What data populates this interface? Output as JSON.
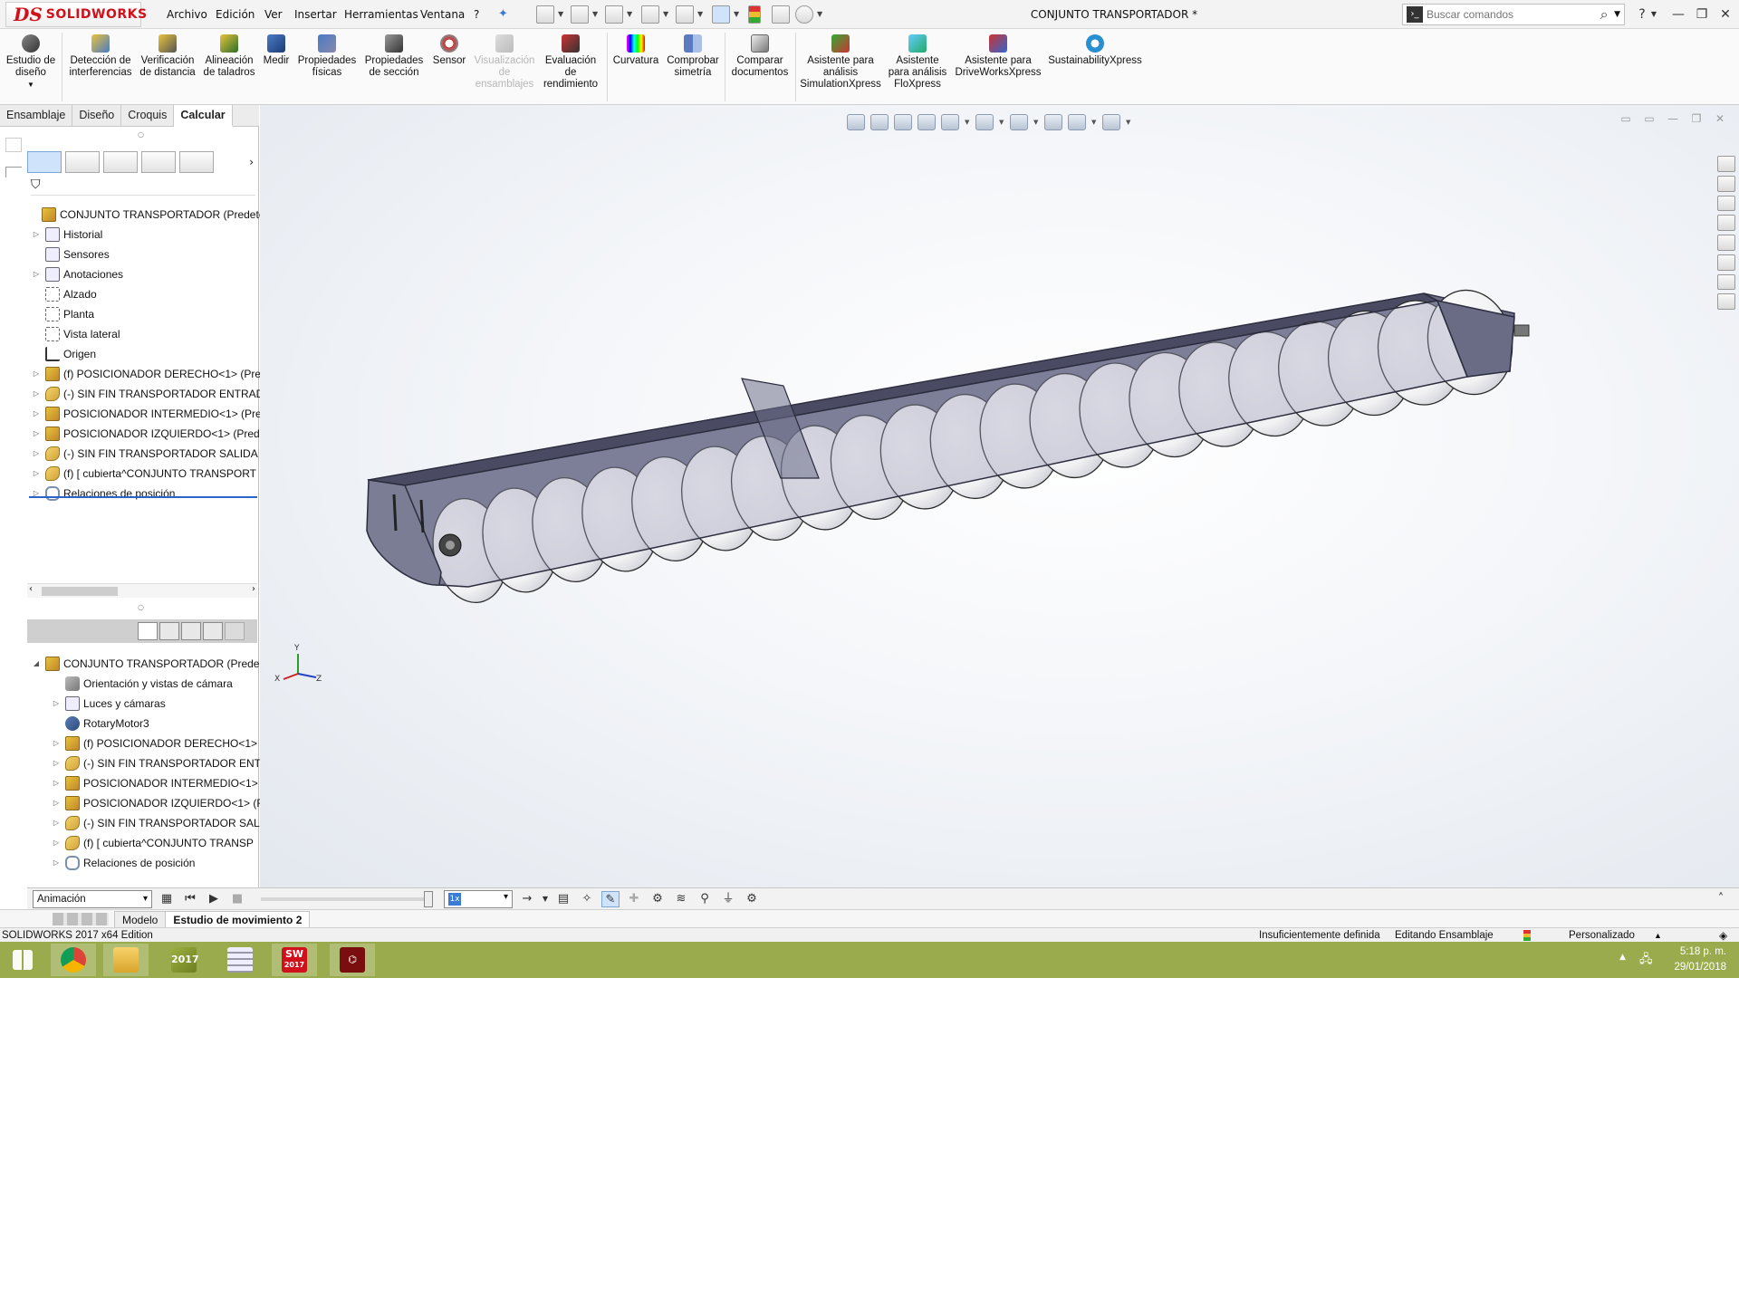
{
  "app": {
    "brand_prefix": "DS",
    "brand": "SOLIDWORKS",
    "document_title": "CONJUNTO TRANSPORTADOR *",
    "menus": [
      "Archivo",
      "Edición",
      "Ver",
      "Insertar",
      "Herramientas",
      "Ventana",
      "?"
    ],
    "search_placeholder": "Buscar comandos",
    "help": "?"
  },
  "ribbon": {
    "design_study": "Estudio de diseño",
    "buttons": [
      {
        "label": "Detección de interferencias",
        "icon": "interference-icon",
        "enabled": true
      },
      {
        "label": "Verificación de distancia",
        "icon": "clearance-icon",
        "enabled": true
      },
      {
        "label": "Alineación de taladros",
        "icon": "hole-alignment-icon",
        "enabled": true
      },
      {
        "label": "Medir",
        "icon": "measure-icon",
        "enabled": true
      },
      {
        "label": "Propiedades físicas",
        "icon": "mass-properties-icon",
        "enabled": true
      },
      {
        "label": "Propiedades de sección",
        "icon": "section-properties-icon",
        "enabled": true
      },
      {
        "label": "Sensor",
        "icon": "sensor-icon",
        "enabled": true
      },
      {
        "label": "Visualización de ensamblajes",
        "icon": "assembly-visualization-icon",
        "enabled": false
      },
      {
        "label": "Evaluación de rendimiento",
        "icon": "performance-icon",
        "enabled": true
      },
      {
        "label": "Curvatura",
        "icon": "curvature-icon",
        "enabled": true
      },
      {
        "label": "Comprobar simetría",
        "icon": "symmetry-icon",
        "enabled": true
      },
      {
        "label": "Comparar documentos",
        "icon": "compare-icon",
        "enabled": true
      },
      {
        "label": "Asistente para análisis SimulationXpress",
        "icon": "simulationxpress-icon",
        "enabled": true
      },
      {
        "label": "Asistente para análisis FloXpress",
        "icon": "floxpress-icon",
        "enabled": true
      },
      {
        "label": "Asistente para DriveWorksXpress",
        "icon": "driveworksxpress-icon",
        "enabled": true
      },
      {
        "label": "SustainabilityXpress",
        "icon": "sustainability-icon",
        "enabled": true
      }
    ]
  },
  "command_tabs": [
    "Ensamblaje",
    "Diseño",
    "Croquis",
    "Calcular"
  ],
  "active_command_tab": "Calcular",
  "feature_tree": {
    "root": "CONJUNTO TRANSPORTADOR  (Predeterm",
    "items": [
      {
        "label": "Historial",
        "icon": "history-folder-icon",
        "expandable": true
      },
      {
        "label": "Sensores",
        "icon": "sensors-folder-icon",
        "expandable": false
      },
      {
        "label": "Anotaciones",
        "icon": "annotations-folder-icon",
        "expandable": true
      },
      {
        "label": "Alzado",
        "icon": "plane-icon",
        "expandable": false
      },
      {
        "label": "Planta",
        "icon": "plane-icon",
        "expandable": false
      },
      {
        "label": "Vista lateral",
        "icon": "plane-icon",
        "expandable": false
      },
      {
        "label": "Origen",
        "icon": "origin-icon",
        "expandable": false
      },
      {
        "label": "(f) POSICIONADOR DERECHO<1> (Pre",
        "icon": "subassembly-icon",
        "expandable": true
      },
      {
        "label": "(-) SIN FIN TRANSPORTADOR ENTRAD",
        "icon": "part-icon",
        "expandable": true
      },
      {
        "label": "POSICIONADOR INTERMEDIO<1> (Pre",
        "icon": "subassembly-icon",
        "expandable": true
      },
      {
        "label": "POSICIONADOR IZQUIERDO<1> (Predi",
        "icon": "subassembly-icon",
        "expandable": true
      },
      {
        "label": "(-) SIN FIN TRANSPORTADOR  SALIDA",
        "icon": "part-icon",
        "expandable": true
      },
      {
        "label": "(f) [ cubierta^CONJUNTO TRANSPORT",
        "icon": "part-icon",
        "expandable": true
      },
      {
        "label": "Relaciones de posición",
        "icon": "mates-icon",
        "expandable": true
      }
    ]
  },
  "motion_tree": {
    "root": "CONJUNTO TRANSPORTADOR  (Prede",
    "items": [
      {
        "label": "Orientación y vistas de cámara",
        "icon": "camera-views-icon",
        "expandable": false
      },
      {
        "label": "Luces y cámaras",
        "icon": "lights-icon",
        "expandable": true
      },
      {
        "label": "RotaryMotor3",
        "icon": "rotary-motor-icon",
        "expandable": false
      },
      {
        "label": "(f) POSICIONADOR DERECHO<1>",
        "icon": "subassembly-icon",
        "expandable": true
      },
      {
        "label": "(-) SIN FIN TRANSPORTADOR ENT",
        "icon": "part-icon",
        "expandable": true
      },
      {
        "label": "POSICIONADOR INTERMEDIO<1>",
        "icon": "subassembly-icon",
        "expandable": true
      },
      {
        "label": "POSICIONADOR IZQUIERDO<1> (F",
        "icon": "subassembly-icon",
        "expandable": true
      },
      {
        "label": "(-) SIN FIN TRANSPORTADOR  SAL",
        "icon": "part-icon",
        "expandable": true
      },
      {
        "label": "(f) [ cubierta^CONJUNTO TRANSP",
        "icon": "part-icon",
        "expandable": true
      },
      {
        "label": "Relaciones de posición",
        "icon": "mates-icon",
        "expandable": true
      }
    ]
  },
  "motion": {
    "study_type": "Animación",
    "speed": "1x"
  },
  "bottom_tabs": [
    "Modelo",
    "Estudio de movimiento 2"
  ],
  "active_bottom_tab": "Estudio de movimiento 2",
  "status": {
    "edition": "SOLIDWORKS 2017 x64 Edition",
    "definition": "Insuficientemente definida",
    "mode": "Editando Ensamblaje",
    "units": "Personalizado"
  },
  "triad": {
    "x": "X",
    "y": "Y",
    "z": "Z"
  },
  "taskbar": {
    "apps": [
      {
        "name": "start-icon"
      },
      {
        "name": "chrome-icon"
      },
      {
        "name": "file-explorer-icon"
      },
      {
        "name": "solidworks-launcher-icon",
        "label": "2017"
      },
      {
        "name": "calculator-icon"
      },
      {
        "name": "solidworks-app-icon",
        "label": "2017",
        "badge": "SW"
      },
      {
        "name": "acrobat-icon"
      }
    ],
    "time": "5:18 p. m.",
    "date": "29/01/2018"
  },
  "colors": {
    "brand_red": "#d0111b",
    "taskbar": "#9aab4d",
    "trough": "#6e6f88",
    "auger": "#ffffff",
    "tree_selection": "#2a64c8"
  }
}
